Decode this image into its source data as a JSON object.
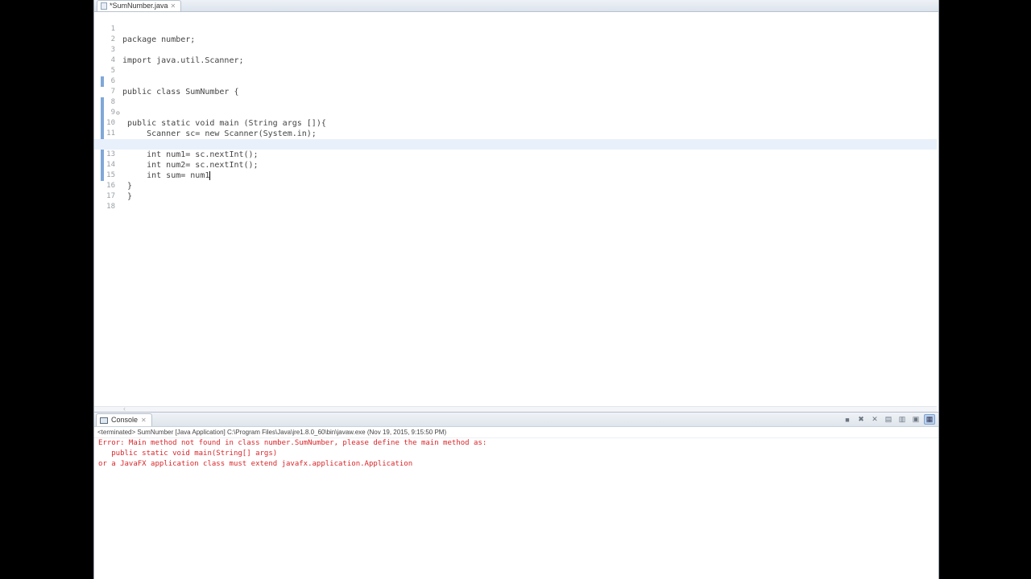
{
  "editor": {
    "tab_label": "*SumNumber.java",
    "tab_close": "✕",
    "lines": [
      {
        "n": "1",
        "code": "package number;"
      },
      {
        "n": "2",
        "code": ""
      },
      {
        "n": "3",
        "code": "import java.util.Scanner;"
      },
      {
        "n": "4",
        "code": ""
      },
      {
        "n": "5",
        "code": ""
      },
      {
        "n": "6",
        "code": "public class SumNumber {"
      },
      {
        "n": "7",
        "code": " public static void main (String args []){"
      },
      {
        "n": "8",
        "code": ""
      },
      {
        "n": "9",
        "code": "     Scanner sc= new Scanner(System.in);"
      },
      {
        "n": "10",
        "code": ""
      },
      {
        "n": "11",
        "code": "     int num1= sc.nextInt();"
      },
      {
        "n": "12",
        "code": "     int num2= sc.nextInt();"
      },
      {
        "n": "13",
        "code": "     int sum= num1"
      },
      {
        "n": "14",
        "code": " }"
      },
      {
        "n": "15",
        "code": ""
      },
      {
        "n": "16",
        "code": " }"
      },
      {
        "n": "17",
        "code": ""
      },
      {
        "n": "18",
        "code": ""
      }
    ]
  },
  "console": {
    "tab_label": "Console",
    "tab_close": "✕",
    "toolbar_icons": [
      "remove-launch-icon",
      "remove-all-icon",
      "clear-console-icon",
      "scroll-lock-icon",
      "pin-console-icon",
      "display-console-icon",
      "open-console-icon"
    ],
    "status": "<terminated> SumNumber [Java Application] C:\\Program Files\\Java\\jre1.8.0_60\\bin\\javaw.exe (Nov 19, 2015, 9:15:50 PM)",
    "output": [
      "Error: Main method not found in class number.SumNumber, please define the main method as:",
      "   public static void main(String[] args)",
      "or a JavaFX application class must extend javafx.application.Application"
    ],
    "output_color": "#d8262a"
  }
}
